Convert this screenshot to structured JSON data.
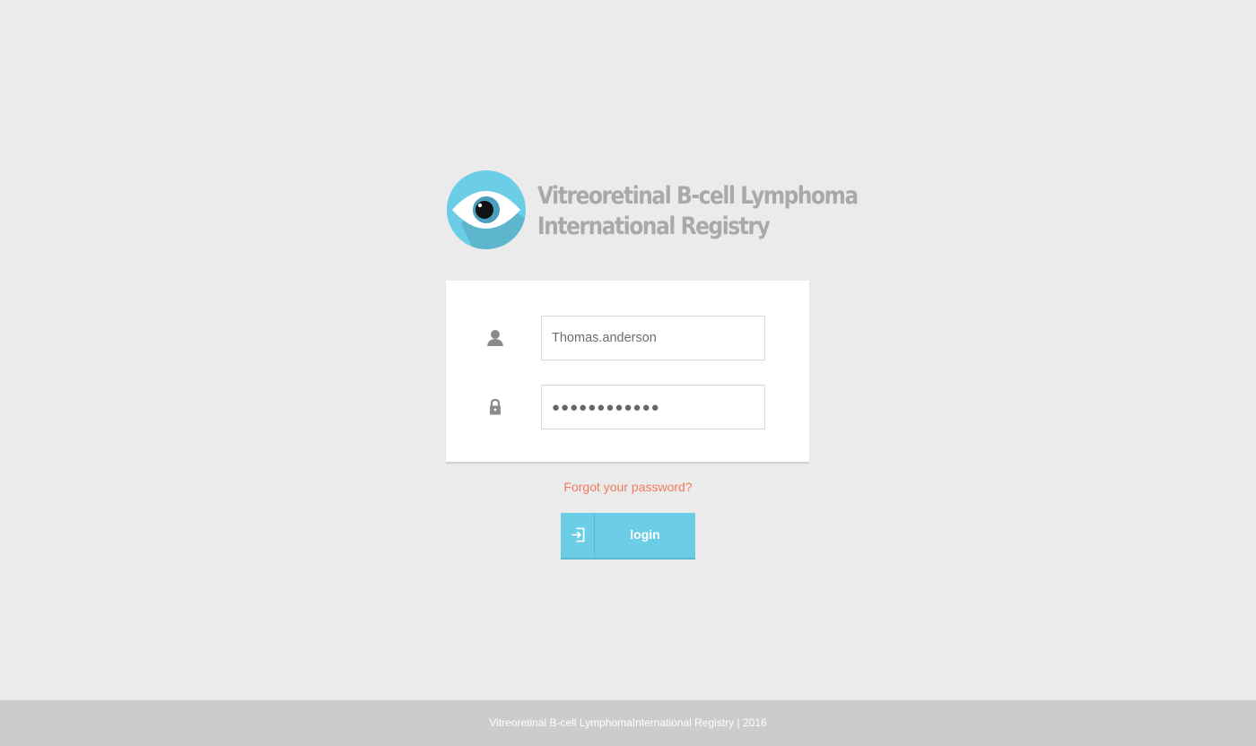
{
  "brand": {
    "title_line1": "Vitreoretinal B-cell Lymphoma",
    "title_line2": "International Registry",
    "logo_icon": "eye-icon",
    "logo_color": "#6ccde6"
  },
  "login_form": {
    "username": {
      "icon": "user-icon",
      "value": "Thomas.anderson"
    },
    "password": {
      "icon": "lock-icon",
      "value": "●●●●●●●●●●●●"
    }
  },
  "forgot_password": {
    "label": "Forgot your password?",
    "color": "#f07b5c"
  },
  "login_button": {
    "label": "login",
    "icon": "sign-in-icon",
    "color": "#6ccde6"
  },
  "footer": {
    "text": "Vitreoretinal B-cell LymphomaInternational Registry | 2016"
  }
}
